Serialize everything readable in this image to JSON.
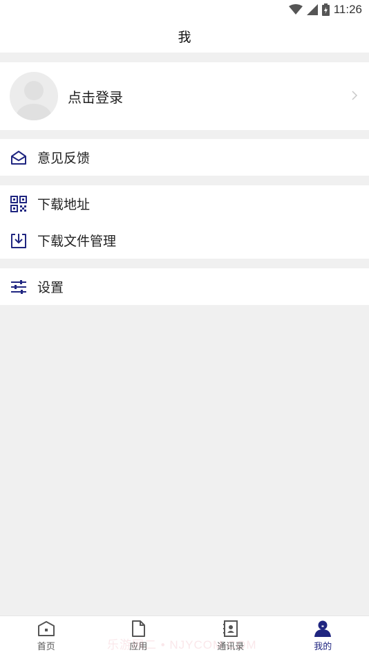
{
  "status_bar": {
    "time": "11:26"
  },
  "header": {
    "title": "我"
  },
  "login": {
    "label": "点击登录"
  },
  "menu_groups": [
    {
      "items": [
        {
          "label": "意见反馈",
          "icon": "mail-open-icon"
        }
      ]
    },
    {
      "items": [
        {
          "label": "下载地址",
          "icon": "qrcode-icon"
        },
        {
          "label": "下载文件管理",
          "icon": "download-icon"
        }
      ]
    },
    {
      "items": [
        {
          "label": "设置",
          "icon": "sliders-icon"
        }
      ]
    }
  ],
  "tabbar": {
    "tabs": [
      {
        "label": "首页",
        "icon": "home-icon",
        "active": false
      },
      {
        "label": "应用",
        "icon": "document-icon",
        "active": false
      },
      {
        "label": "通讯录",
        "icon": "contacts-icon",
        "active": false
      },
      {
        "label": "我的",
        "icon": "user-icon",
        "active": true
      }
    ]
  },
  "watermark": "乐游网二 • NJYCOM.COM",
  "colors": {
    "accent": "#1f2580",
    "background": "#f0f0f0",
    "card": "#ffffff"
  }
}
